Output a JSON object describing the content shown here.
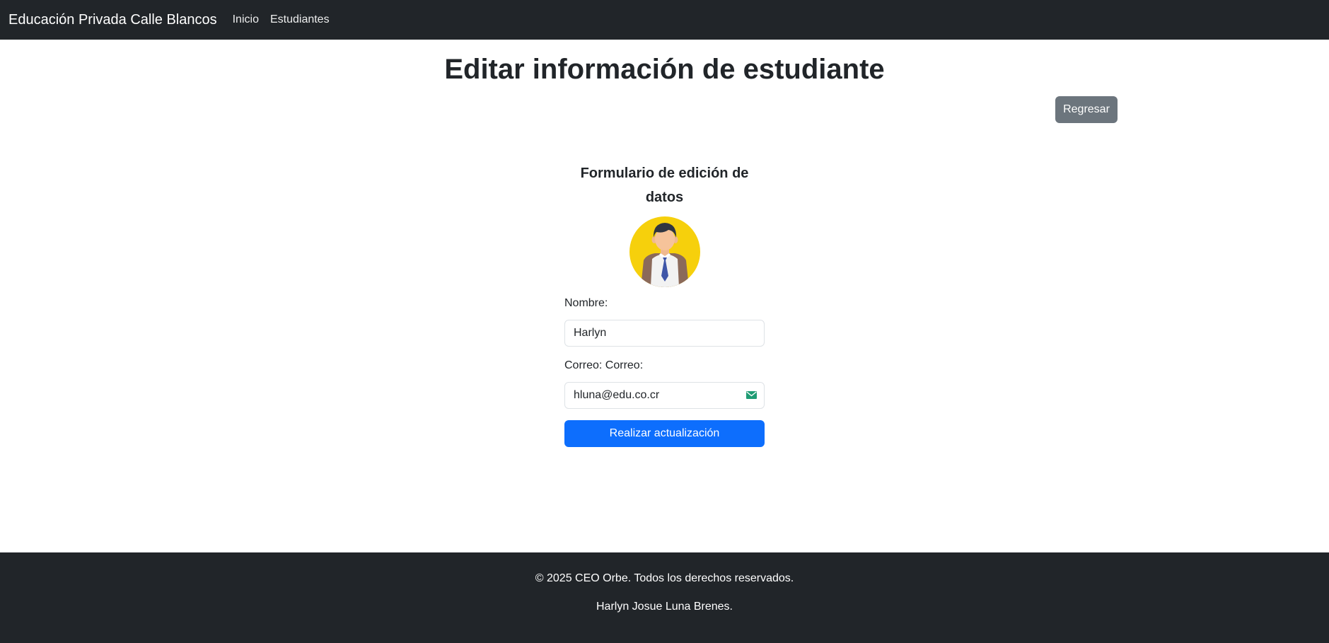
{
  "navbar": {
    "brand": "Educación Privada Calle Blancos",
    "links": [
      "Inicio",
      "Estudiantes"
    ]
  },
  "page": {
    "title": "Editar información de estudiante",
    "back_button": "Regresar"
  },
  "form": {
    "title": "Formulario de edición de datos",
    "avatar_icon": "student-avatar-icon",
    "name_label": "Nombre:",
    "name_value": "Harlyn",
    "email_label": "Correo: Correo:",
    "email_value": "hluna@edu.co.cr",
    "email_icon": "mail-icon",
    "submit_label": "Realizar actualización"
  },
  "footer": {
    "copyright": "© 2025 CEO Orbe. Todos los derechos reservados.",
    "author": "Harlyn Josue Luna Brenes."
  },
  "colors": {
    "navbar_bg": "#212529",
    "primary": "#0d6efd",
    "secondary": "#6c757d",
    "avatar_bg": "#f6d00c"
  }
}
